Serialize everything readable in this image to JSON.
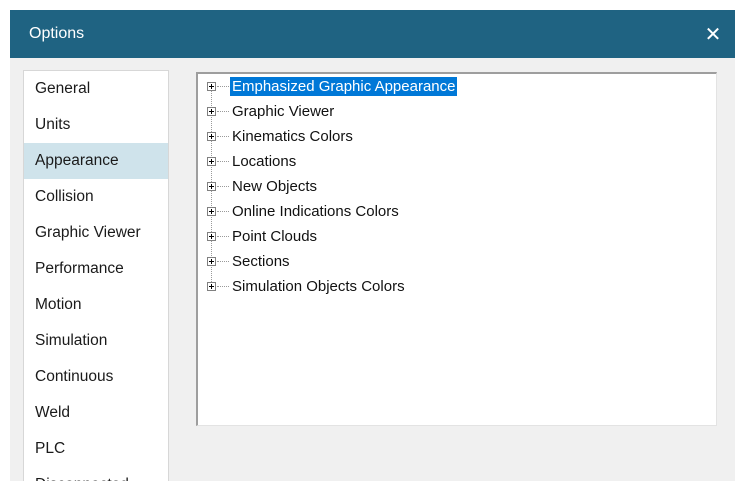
{
  "window": {
    "title": "Options",
    "close_glyph": "✕",
    "accent_color": "#1f6382"
  },
  "nav": {
    "selected_index": 2,
    "items": [
      {
        "label": "General"
      },
      {
        "label": "Units"
      },
      {
        "label": "Appearance"
      },
      {
        "label": "Collision"
      },
      {
        "label": "Graphic Viewer"
      },
      {
        "label": "Performance"
      },
      {
        "label": "Motion"
      },
      {
        "label": "Simulation"
      },
      {
        "label": "Continuous"
      },
      {
        "label": "Weld"
      },
      {
        "label": "PLC"
      },
      {
        "label": "Disconnected"
      }
    ]
  },
  "tree": {
    "selected_index": 0,
    "items": [
      {
        "label": "Emphasized Graphic Appearance"
      },
      {
        "label": "Graphic Viewer"
      },
      {
        "label": "Kinematics Colors"
      },
      {
        "label": "Locations"
      },
      {
        "label": "New Objects"
      },
      {
        "label": "Online Indications Colors"
      },
      {
        "label": "Point Clouds"
      },
      {
        "label": "Sections"
      },
      {
        "label": "Simulation Objects Colors"
      }
    ]
  }
}
